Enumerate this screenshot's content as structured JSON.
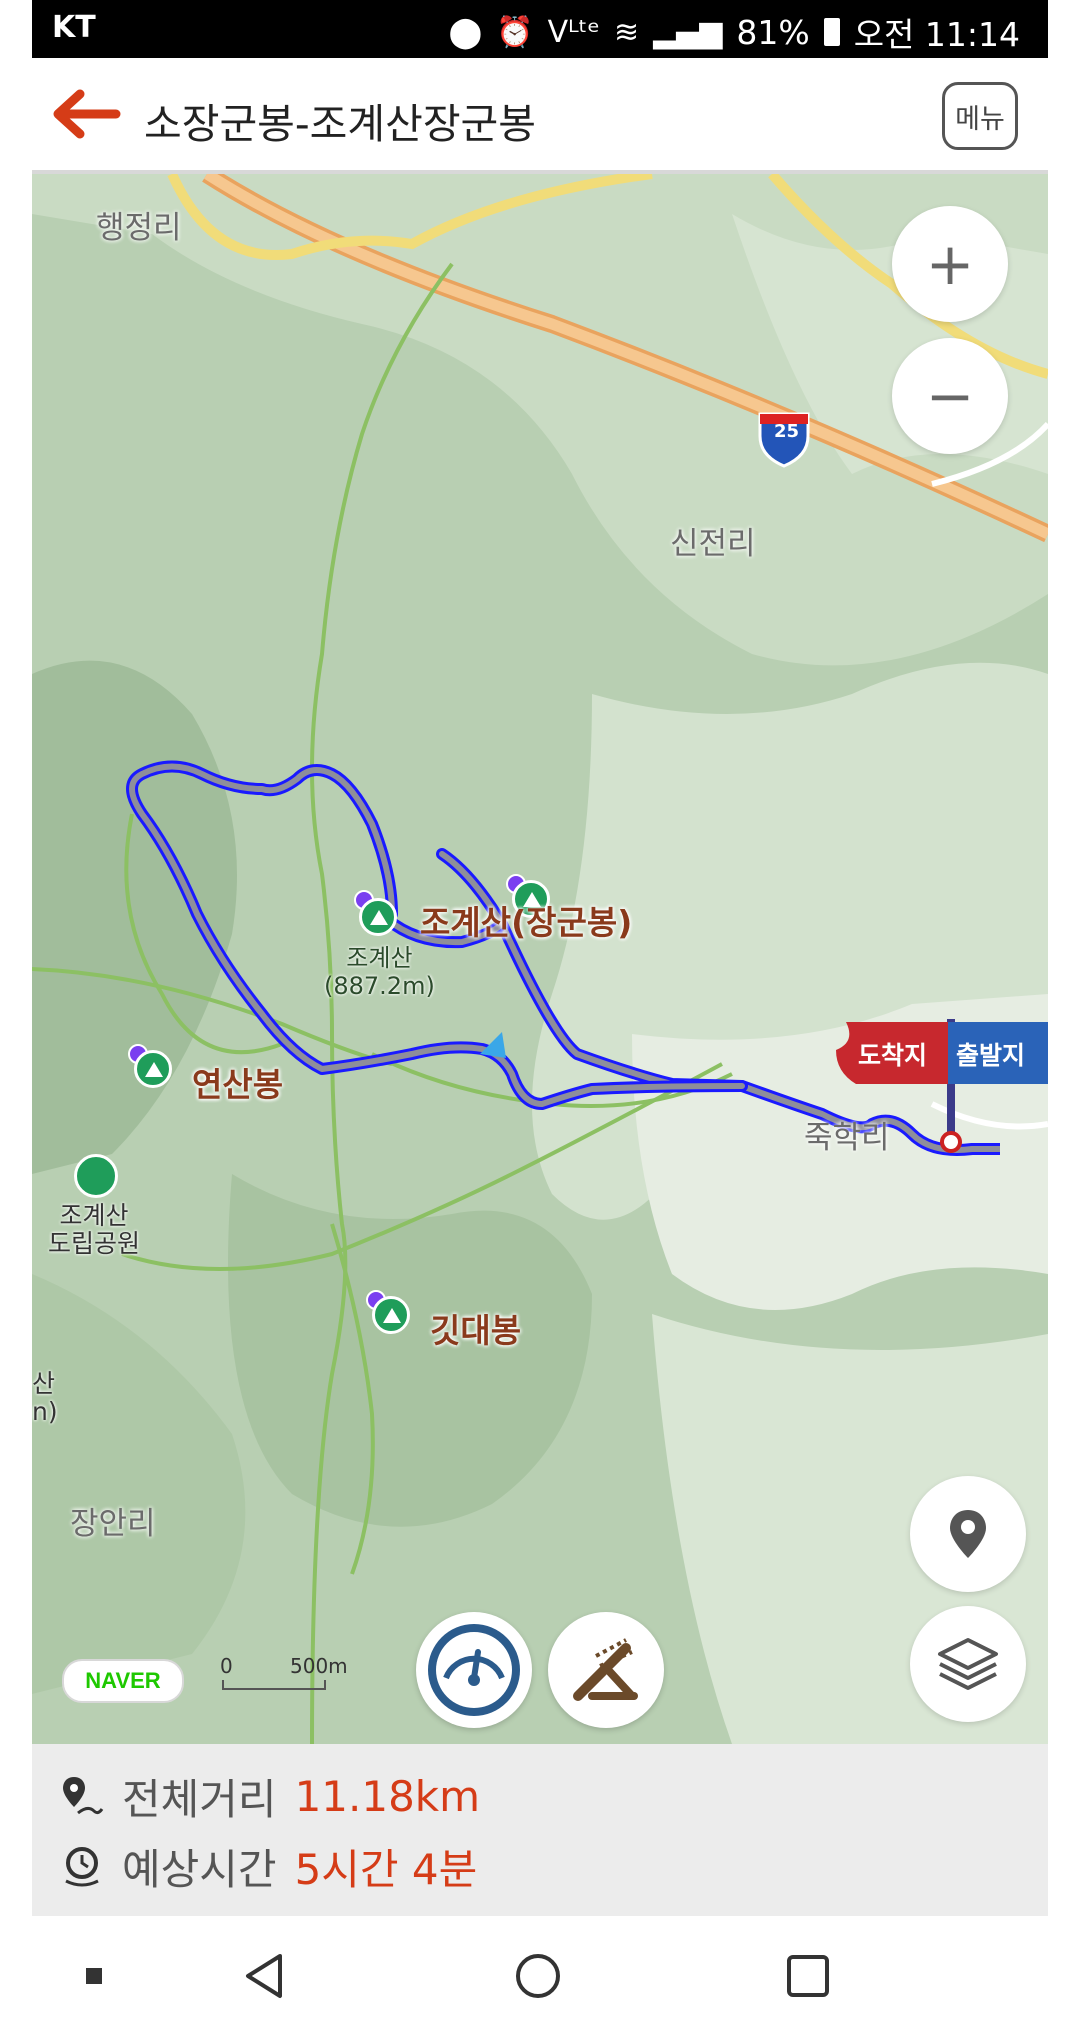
{
  "status_bar": {
    "carrier": "KT",
    "lte_label": "Vᴸᵗᵉ",
    "battery": "81%",
    "time": "오전 11:14"
  },
  "header": {
    "title": "소장군봉-조계산장군봉",
    "menu_label": "메뉴"
  },
  "map": {
    "places": [
      "행정리",
      "신전리",
      "장안리",
      "죽학리"
    ],
    "highway_number": "25",
    "peaks": {
      "janggunbong": "조계산(장군봉)",
      "jogyesan_name": "조계산",
      "jogyesan_height": "(887.2m)",
      "yeonsanbong": "연산봉",
      "gitdaebong": "깃대봉"
    },
    "park": [
      "조계산",
      "도립공원"
    ],
    "edge_label": [
      "산",
      "n)"
    ],
    "arrival_label": "도착지",
    "departure_label": "출발지",
    "naver_logo": "NAVER",
    "scale": {
      "zero": "0",
      "distance": "500m"
    }
  },
  "info": {
    "distance_label": "전체거리",
    "distance_value": "11.18km",
    "time_label": "예상시간",
    "time_value": "5시간 4분"
  },
  "colors": {
    "accent": "#d53c17",
    "route_outline": "#1a1aff",
    "route_fill": "#8e8e9a",
    "arrival_flag": "#c7282e",
    "departure_flag": "#2a63b8"
  },
  "icons": [
    "back-arrow-icon",
    "zoom-in-icon",
    "zoom-out-icon",
    "location-pin-icon",
    "layers-icon",
    "speedometer-icon",
    "elevation-icon",
    "route-distance-icon",
    "clock-icon"
  ]
}
